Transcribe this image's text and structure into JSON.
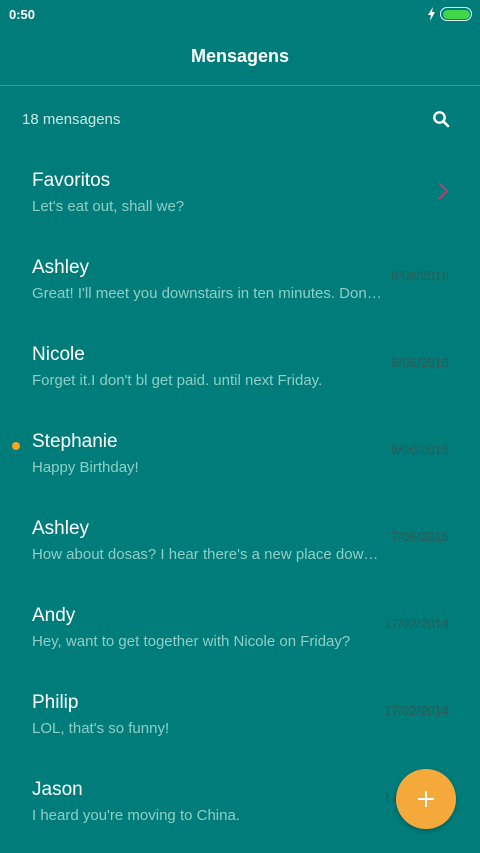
{
  "status_bar": {
    "time": "0:50",
    "battery_level": 1.0
  },
  "header": {
    "title": "Mensagens"
  },
  "sub_header": {
    "count_label": "18 mensagens"
  },
  "colors": {
    "background": "#007d7b",
    "preview_text": "#8fcfc7",
    "date_text": "#2f5a55",
    "accent": "#f5a93a",
    "unread_dot": "#f5a623",
    "chevron": "#b2426a",
    "battery": "#3fd64a"
  },
  "icons": {
    "search": "search-icon",
    "chevron": "chevron-right-icon",
    "fab": "plus-icon",
    "bolt": "charging-bolt-icon",
    "battery": "battery-icon"
  },
  "messages": [
    {
      "name": "Favoritos",
      "preview": "Let's eat out, shall we?",
      "date": "",
      "unread": false,
      "has_chevron": true
    },
    {
      "name": "Ashley",
      "preview": "Great! I'll meet you downstairs in ten minutes. Don't be late!",
      "date": "8/06/2016",
      "unread": false
    },
    {
      "name": "Nicole",
      "preview": "Forget it.I don't bl get paid. until next Friday.",
      "date": "8/06/2016",
      "unread": false
    },
    {
      "name": "Stephanie",
      "preview": "Happy Birthday!",
      "date": "8/06/2016",
      "unread": true
    },
    {
      "name": "Ashley",
      "preview": "How about dosas? I hear there's a new place downtown.",
      "date": "7/06/2016",
      "unread": false
    },
    {
      "name": "Andy",
      "preview": "Hey, want to get together with Nicole on Friday?",
      "date": "17/02/2014",
      "unread": false
    },
    {
      "name": "Philip",
      "preview": "LOL, that's so funny!",
      "date": "17/02/2014",
      "unread": false
    },
    {
      "name": "Jason",
      "preview": "I heard you're moving to China.",
      "date": "17/02/2014",
      "unread": false
    }
  ]
}
